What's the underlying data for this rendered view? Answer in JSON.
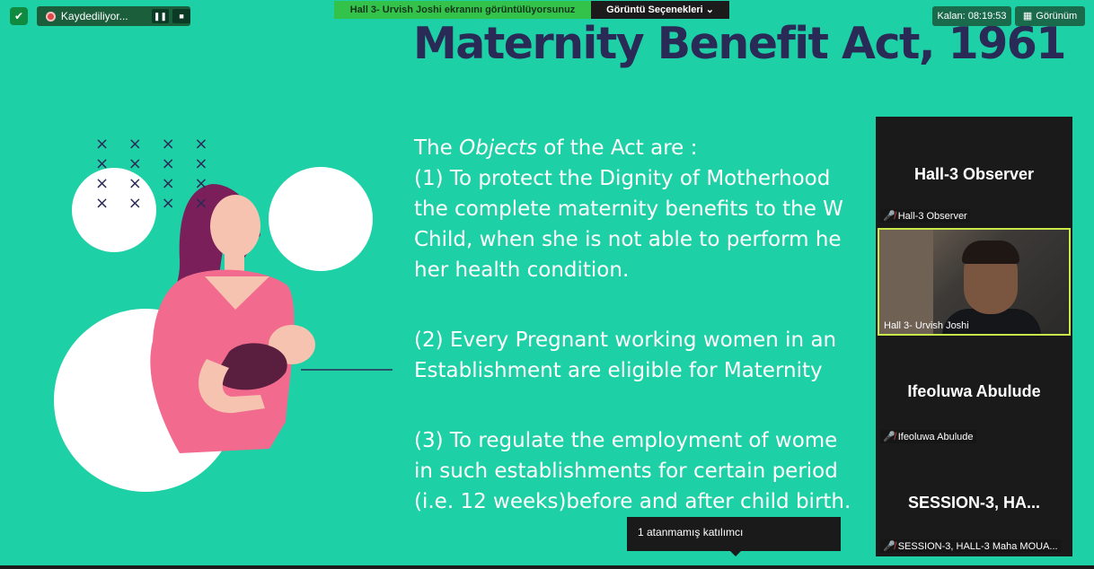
{
  "slide": {
    "title": "Maternity Benefit Act, 1961",
    "body": {
      "l1_pre": "The ",
      "l1_em": "Objects",
      "l1_post": " of the Act are :",
      "l2": "(1) To protect the Dignity of Motherhood",
      "l3": "the complete maternity benefits to the W",
      "l4": "Child, when she is not able to perform he",
      "l5": "her health condition.",
      "l6": "(2) Every Pregnant working women in an",
      "l7": "Establishment are eligible for Maternity",
      "l8": "(3) To regulate the employment of wome",
      "l9": "in such establishments for certain period",
      "l10": "(i.e. 12 weeks)before and after child birth."
    },
    "decor_marks": "× × × ×\n× × × ×\n× × × ×\n× × × ×"
  },
  "recording": {
    "status": "Kaydediliyor...",
    "pause_icon": "❚❚",
    "stop_icon": "■"
  },
  "share_bar": {
    "message": "Hall 3- Urvish Joshi ekranını görüntülüyorsunuz",
    "options_label": "Görüntü Seçenekleri ⌄"
  },
  "timer": "Kalan: 08:19:53",
  "view_button": "Görünüm",
  "participants": [
    {
      "display": "Hall-3 Observer",
      "label": "Hall-3 Observer"
    },
    {
      "label": "Hall 3- Urvish Joshi"
    },
    {
      "display": "Ifeoluwa Abulude",
      "label": "Ifeoluwa Abulude"
    },
    {
      "display": "SESSION-3,  HA...",
      "label": "SESSION-3, HALL-3 Maha MOUA..."
    }
  ],
  "tooltip": "1 atanmamış katılımcı",
  "colors": {
    "slide_bg": "#1ed0a6",
    "title": "#2a2a57",
    "recording": "#1b5e3c",
    "share_green": "#33c34a",
    "active_speaker": "#c8e84a",
    "mic_off": "#e5484d"
  }
}
